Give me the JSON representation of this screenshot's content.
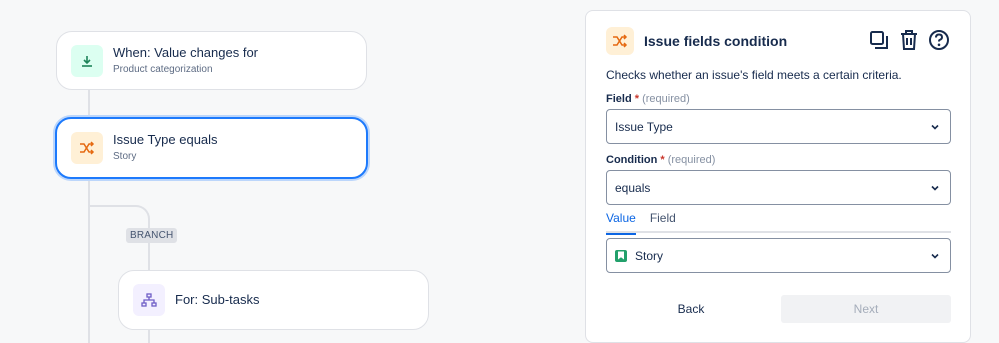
{
  "canvas": {
    "trigger": {
      "title": "When: Value changes for",
      "subtitle": "Product categorization"
    },
    "condition": {
      "title": "Issue Type equals",
      "subtitle": "Story"
    },
    "branch_label": "BRANCH",
    "branch_node": {
      "title": "For: Sub-tasks"
    }
  },
  "panel": {
    "title": "Issue fields condition",
    "description": "Checks whether an issue's field meets a certain criteria.",
    "field": {
      "label": "Field",
      "required_mark": "*",
      "required_text": "(required)",
      "value": "Issue Type"
    },
    "condition": {
      "label": "Condition",
      "required_mark": "*",
      "required_text": "(required)",
      "value": "equals"
    },
    "tabs": [
      "Value",
      "Field"
    ],
    "value_select": "Story",
    "back_label": "Back",
    "next_label": "Next"
  },
  "colors": {
    "accent": "#0c66e4",
    "selected_border": "#1d7afc",
    "story_green": "#22a06b"
  },
  "icons": [
    "download-icon",
    "shuffle-icon",
    "hierarchy-icon",
    "copy-icon",
    "trash-icon",
    "help-icon",
    "chevron-down-icon",
    "story-icon"
  ]
}
